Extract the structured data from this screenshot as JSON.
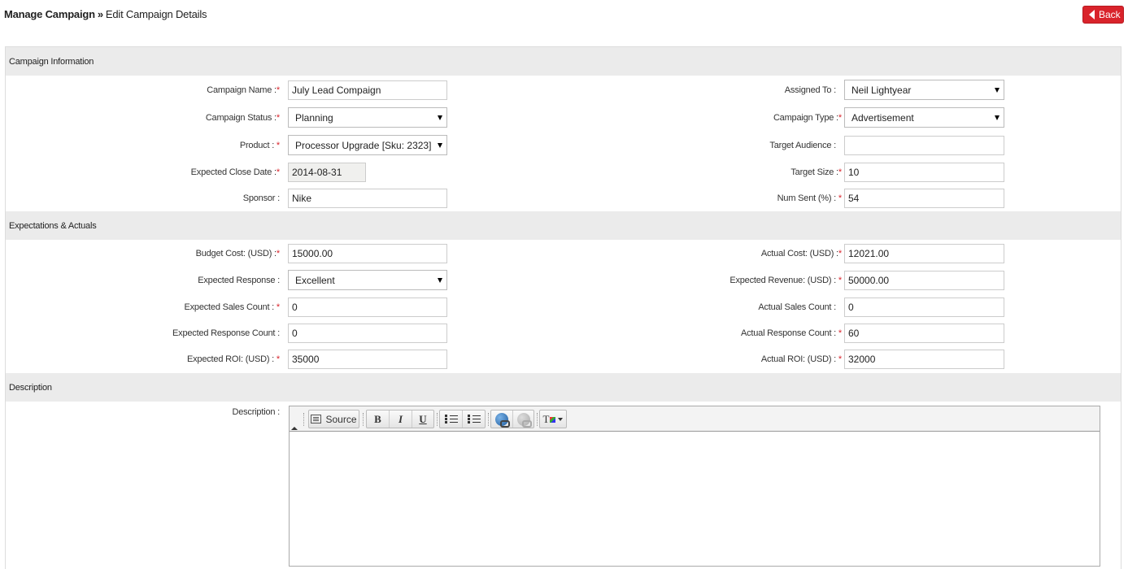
{
  "header": {
    "breadcrumb_root": "Manage Campaign",
    "breadcrumb_separator": "»",
    "breadcrumb_current": "Edit Campaign Details",
    "back_label": "Back"
  },
  "colors": {
    "accent": "#d9232b",
    "section_bg": "#ebebeb",
    "required": "#d9232b"
  },
  "sections": {
    "campaign_info": "Campaign Information",
    "expectations": "Expectations & Actuals",
    "description": "Description"
  },
  "required_mark": "*",
  "campaign_info": {
    "campaign_name": {
      "label": "Campaign Name :",
      "value": "July Lead Compaign"
    },
    "campaign_status": {
      "label": "Campaign Status :",
      "value": "Planning"
    },
    "product": {
      "label": "Product : ",
      "value": "Processor Upgrade [Sku: 2323]"
    },
    "expected_close_date": {
      "label": "Expected Close Date :",
      "value": "2014-08-31"
    },
    "sponsor": {
      "label": "Sponsor :",
      "value": "Nike"
    },
    "assigned_to": {
      "label": "Assigned To :",
      "value": "Neil Lightyear"
    },
    "campaign_type": {
      "label": "Campaign Type :",
      "value": "Advertisement"
    },
    "target_audience": {
      "label": "Target Audience :",
      "value": ""
    },
    "target_size": {
      "label": "Target Size :",
      "value": "10"
    },
    "num_sent": {
      "label": "Num Sent (%) : ",
      "value": "54"
    }
  },
  "expectations": {
    "budget_cost": {
      "label": "Budget Cost: (USD) :",
      "value": "15000.00"
    },
    "expected_response": {
      "label": "Expected Response :",
      "value": "Excellent"
    },
    "expected_sales_count": {
      "label": "Expected Sales Count : ",
      "value": "0"
    },
    "expected_response_count": {
      "label": "Expected Response Count :",
      "value": "0"
    },
    "expected_roi": {
      "label": "Expected ROI: (USD) : ",
      "value": "35000"
    },
    "actual_cost": {
      "label": "Actual Cost: (USD) :",
      "value": "12021.00"
    },
    "expected_revenue": {
      "label": "Expected Revenue: (USD) : ",
      "value": "50000.00"
    },
    "actual_sales_count": {
      "label": "Actual Sales Count :",
      "value": "0"
    },
    "actual_response_count": {
      "label": "Actual Response Count : ",
      "value": "60"
    },
    "actual_roi": {
      "label": "Actual ROI: (USD) : ",
      "value": "32000"
    }
  },
  "description": {
    "label": "Description :",
    "toolbar": {
      "source_label": "Source",
      "bold_label": "B",
      "italic_label": "I",
      "underline_label": "U",
      "text_color_label": "T",
      "icons": [
        "source-icon",
        "bold-icon",
        "italic-icon",
        "underline-icon",
        "numbered-list-icon",
        "bulleted-list-icon",
        "link-icon",
        "unlink-icon",
        "text-color-icon"
      ]
    },
    "value": ""
  }
}
